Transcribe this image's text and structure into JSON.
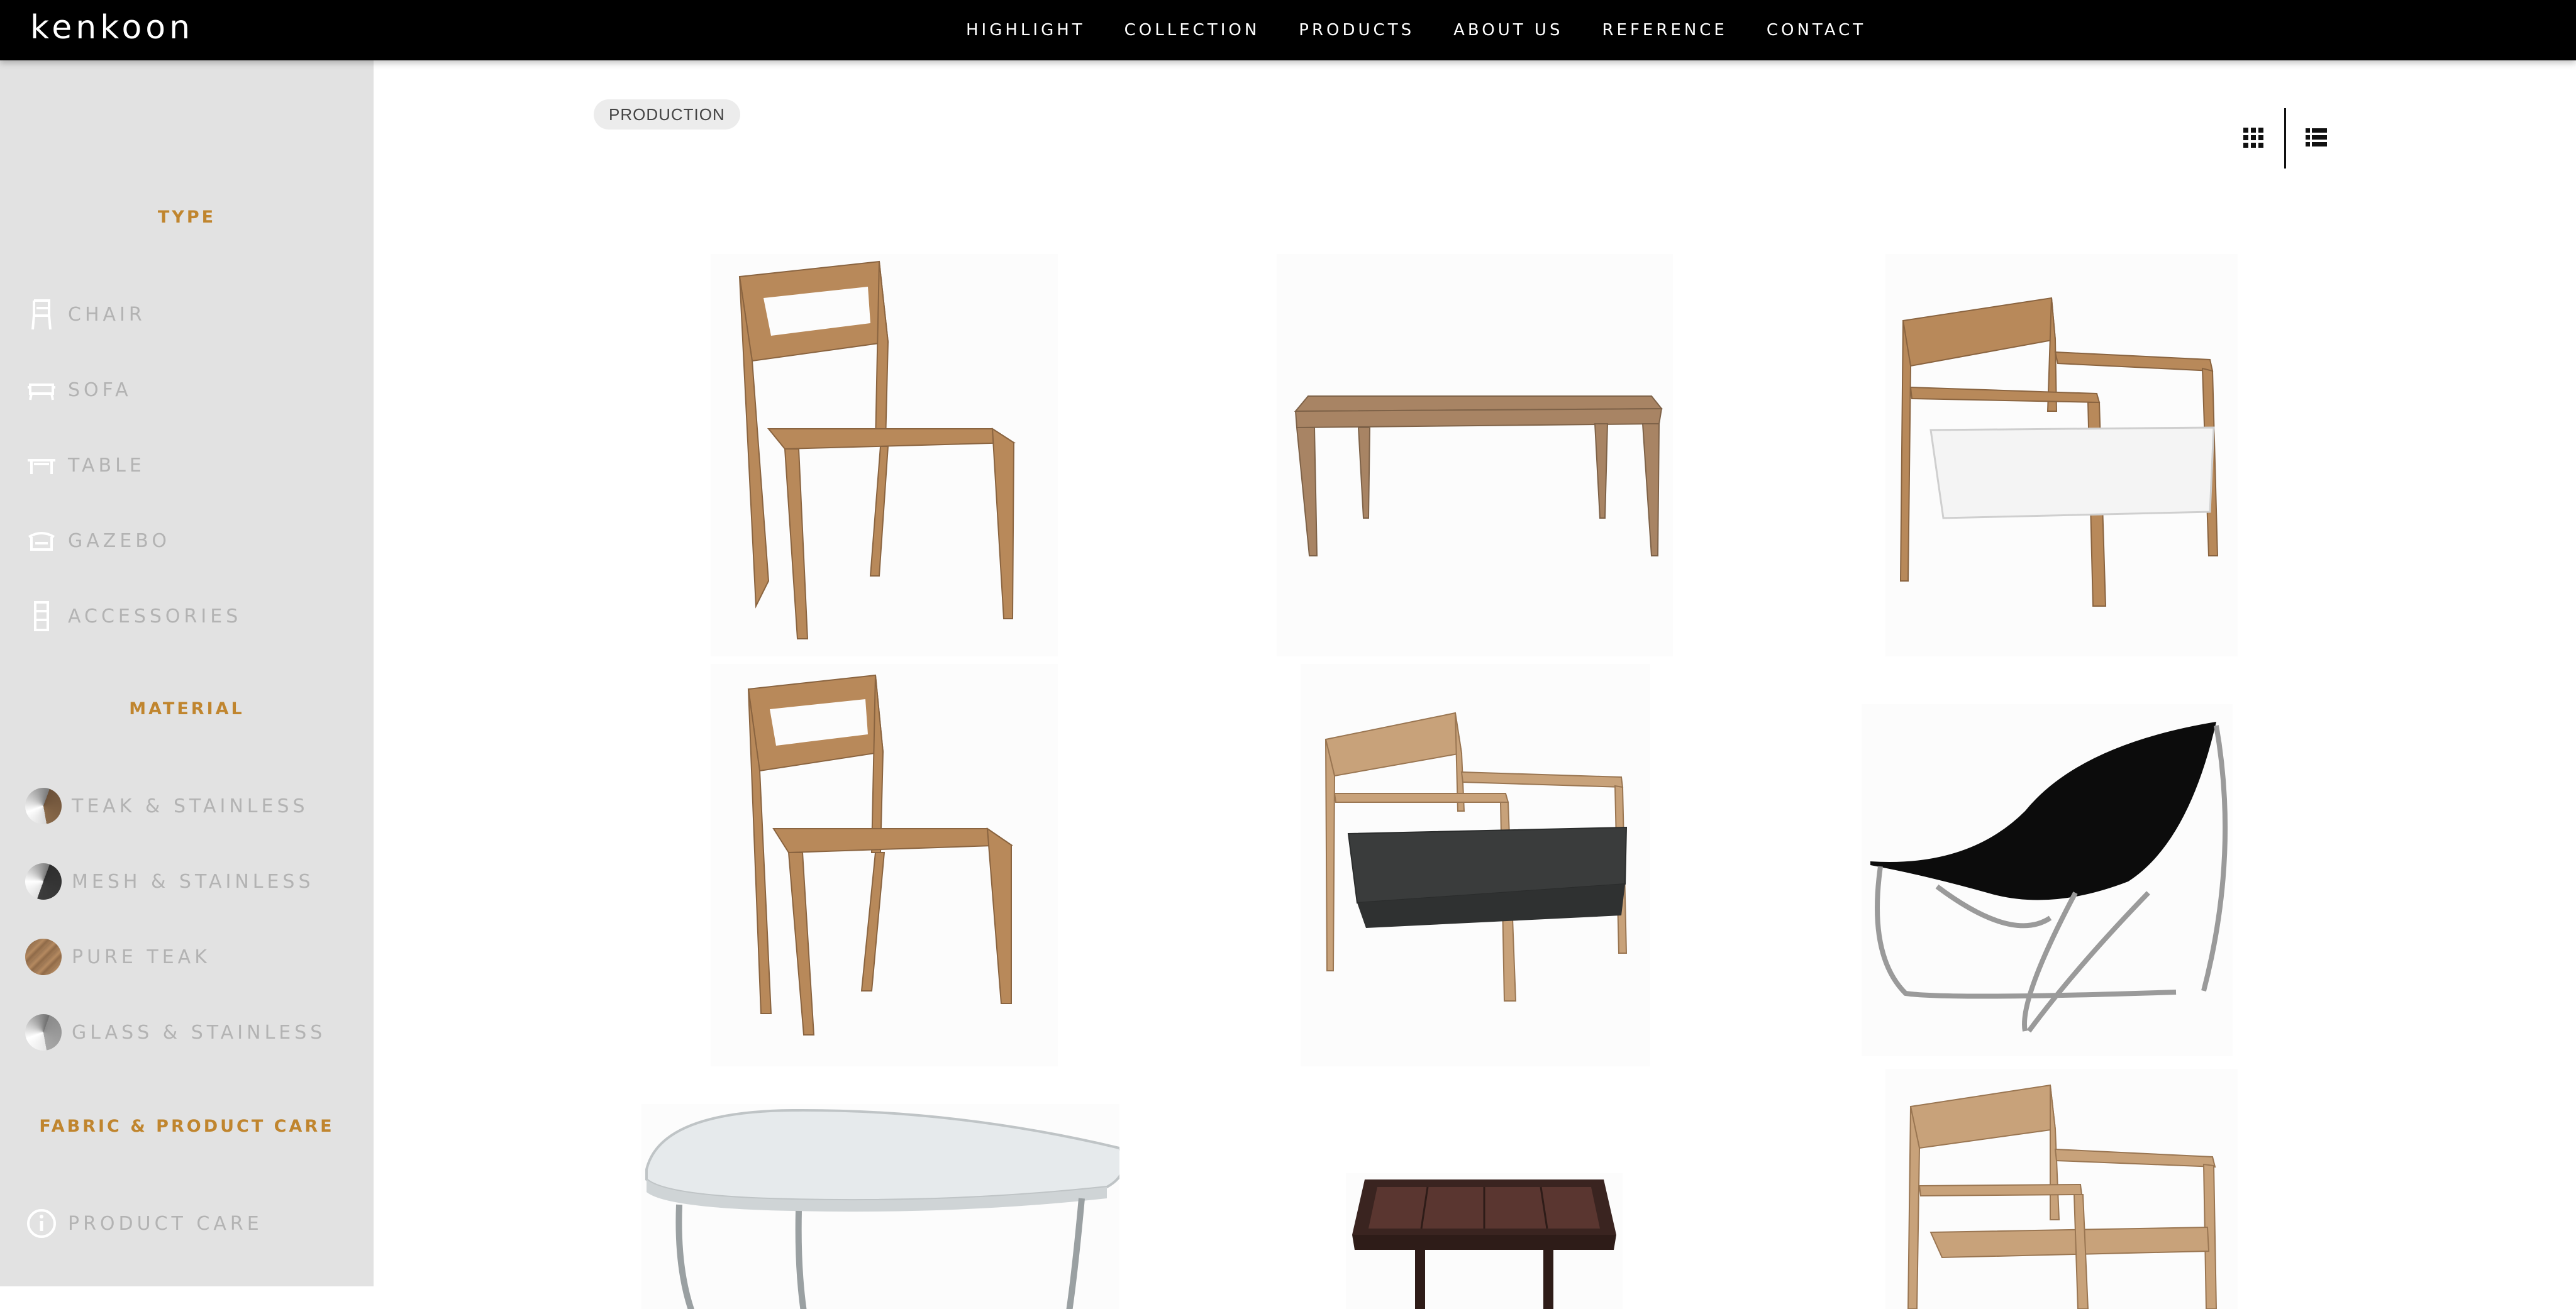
{
  "header": {
    "logo": "kenkoon",
    "nav": [
      "HIGHLIGHT",
      "COLLECTION",
      "PRODUCTS",
      "ABOUT US",
      "REFERENCE",
      "CONTACT"
    ]
  },
  "sidebar": {
    "type_title": "TYPE",
    "types": [
      {
        "label": "CHAIR",
        "icon": "chair-icon"
      },
      {
        "label": "SOFA",
        "icon": "sofa-icon"
      },
      {
        "label": "TABLE",
        "icon": "table-icon"
      },
      {
        "label": "GAZEBO",
        "icon": "gazebo-icon"
      },
      {
        "label": "ACCESSORIES",
        "icon": "accessories-icon"
      }
    ],
    "material_title": "MATERIAL",
    "materials": [
      {
        "label": "TEAK & STAINLESS",
        "icon": "teak-stainless-swatch-icon"
      },
      {
        "label": "MESH & STAINLESS",
        "icon": "mesh-stainless-swatch-icon"
      },
      {
        "label": "PURE TEAK",
        "icon": "pure-teak-swatch-icon"
      },
      {
        "label": "GLASS & STAINLESS",
        "icon": "glass-stainless-swatch-icon"
      }
    ],
    "care_title": "FABRIC & PRODUCT CARE",
    "care_item": {
      "label": "PRODUCT CARE",
      "icon": "info-icon"
    }
  },
  "main": {
    "breadcrumb": "PRODUCTION",
    "view_toggle": [
      "grid-view-icon",
      "list-view-icon"
    ]
  },
  "colors": {
    "accent": "#c0852e",
    "topbar": "#000000",
    "sidebar_bg": "#e2e2e2",
    "teak": "#b8895a",
    "cushion_dark": "#3a3c3c"
  }
}
